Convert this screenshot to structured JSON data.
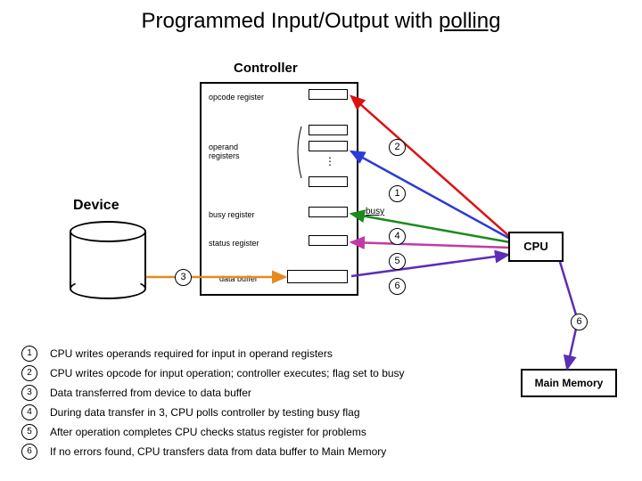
{
  "title_a": "Programmed Input/Output with ",
  "title_b": "polling",
  "controller_label": "Controller",
  "device_label": "Device",
  "cpu_label": "CPU",
  "memory_label": "Main Memory",
  "labels": {
    "opcode": "opcode register",
    "operand": "operand\nregisters",
    "busy": "busy register",
    "status": "status register",
    "databuf": "data buffer",
    "busy_flag": "busy"
  },
  "num": {
    "n1": "1",
    "n2": "2",
    "n3": "3",
    "n4": "4",
    "n5": "5",
    "n6": "6"
  },
  "steps": {
    "s1": "CPU writes operands required for input in operand registers",
    "s2": "CPU writes opcode for input operation; controller executes; flag set to busy",
    "s3": "Data transferred from device to data buffer",
    "s4": "During data transfer in 3, CPU polls controller by testing busy flag",
    "s5": "After operation completes CPU checks status register for problems",
    "s6": "If no errors found, CPU transfers data from data buffer to Main Memory"
  }
}
